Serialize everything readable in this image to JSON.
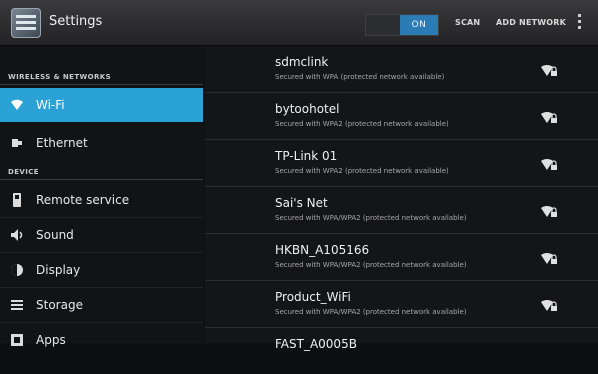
{
  "actionbar": {
    "title": "Settings",
    "toggle_label": "ON",
    "scan_label": "SCAN",
    "add_network_label": "ADD NETWORK"
  },
  "sidebar": {
    "sections": [
      {
        "header": "WIRELESS & NETWORKS"
      },
      {
        "header": "DEVICE"
      }
    ],
    "items": [
      {
        "label": "Wi-Fi",
        "icon": "wifi-icon",
        "selected": true
      },
      {
        "label": "Ethernet",
        "icon": "ethernet-icon",
        "selected": false
      },
      {
        "label": "Remote service",
        "icon": "remote-icon",
        "selected": false
      },
      {
        "label": "Sound",
        "icon": "sound-icon",
        "selected": false
      },
      {
        "label": "Display",
        "icon": "display-icon",
        "selected": false
      },
      {
        "label": "Storage",
        "icon": "storage-icon",
        "selected": false
      },
      {
        "label": "Apps",
        "icon": "apps-icon",
        "selected": false
      }
    ]
  },
  "networks": [
    {
      "ssid": "sdmclink",
      "status": "Secured with WPA (protected network available)",
      "icon": "wifi-locked-icon"
    },
    {
      "ssid": "bytoohotel",
      "status": "Secured with WPA2 (protected network available)",
      "icon": "wifi-locked-icon"
    },
    {
      "ssid": "TP-Link 01",
      "status": "Secured with WPA2 (protected network available)",
      "icon": "wifi-locked-icon"
    },
    {
      "ssid": "Sai's Net",
      "status": "Secured with WPA/WPA2 (protected network available)",
      "icon": "wifi-locked-icon"
    },
    {
      "ssid": "HKBN_A105166",
      "status": "Secured with WPA/WPA2 (protected network available)",
      "icon": "wifi-locked-icon"
    },
    {
      "ssid": "Product_WiFi",
      "status": "Secured with WPA/WPA2 (protected network available)",
      "icon": "wifi-locked-icon"
    },
    {
      "ssid": "FAST_A0005B",
      "status": "",
      "icon": "wifi-locked-icon"
    }
  ],
  "colors": {
    "accent": "#2aa2d6",
    "toggle_on": "#2b7bb5",
    "background": "#101113"
  }
}
